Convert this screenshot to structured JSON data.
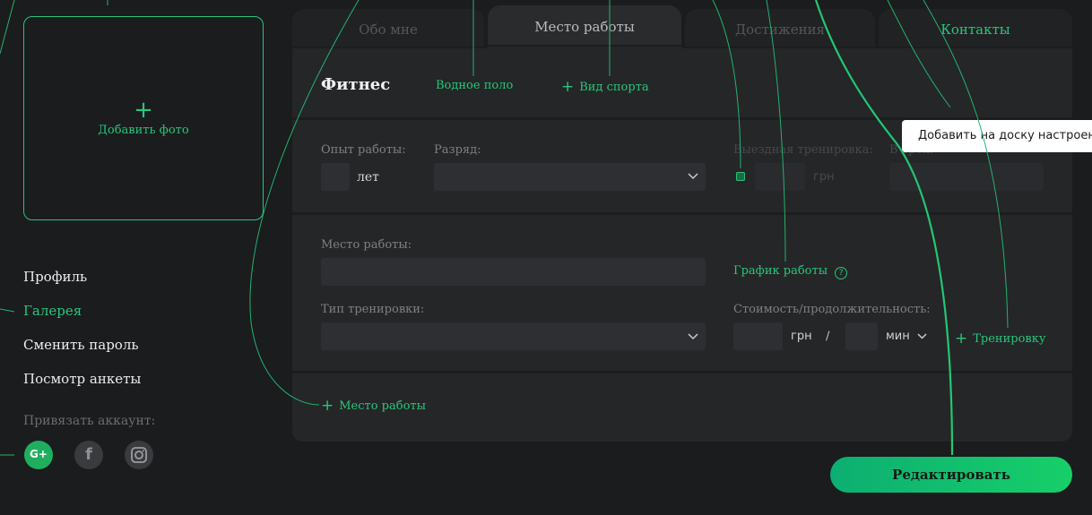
{
  "photo": {
    "plus": "+",
    "label": "Добавить фото"
  },
  "menu": {
    "items": [
      {
        "label": "Профиль",
        "active": false
      },
      {
        "label": "Галерея",
        "active": true
      },
      {
        "label": "Сменить пароль",
        "active": false
      },
      {
        "label": "Посмотр анкеты",
        "active": false
      }
    ],
    "bind_account_label": "Привязать аккаунт:"
  },
  "social": [
    {
      "icon": "google-plus-icon",
      "text": "G+",
      "color": "#1fae5e"
    },
    {
      "icon": "facebook-icon",
      "text": "f",
      "color": "#393b3e"
    },
    {
      "icon": "instagram-icon",
      "text": "",
      "color": "#393b3e"
    }
  ],
  "tabs": [
    {
      "label": "Обо мне",
      "active": false
    },
    {
      "label": "Место работы",
      "active": true
    },
    {
      "label": "Достижения",
      "active": false
    },
    {
      "label": "Контакты",
      "active": false
    }
  ],
  "sport": {
    "title": "Фитнес",
    "sub_sport": "Водное поло",
    "add_sport": "Вид спорта"
  },
  "row1": {
    "experience_label": "Опыт работы:",
    "experience_value": "",
    "experience_unit": "лет",
    "rank_label": "Разряд:",
    "rank_value": "",
    "outdoor_label": "Выездная тренировка:",
    "outdoor_unit": "грн",
    "in_time_label": "В срок:"
  },
  "row2": {
    "workplace_label": "Место работы:",
    "workplace_value": "",
    "schedule_link": "График работы",
    "schedule_help": "?",
    "training_type_label": "Тип тренировки:",
    "training_type_value": "",
    "cost_label": "Стоимость/продолжительность:",
    "cost_unit": "грн",
    "separator": "/",
    "duration_unit": "мин",
    "add_training": "Тренировку"
  },
  "add_workplace": "Место работы",
  "tooltip": "Добавить на доску настроения",
  "edit_button": "Редактировать",
  "colors": {
    "accent": "#27c77a",
    "background": "#1b1c1e",
    "card": "#252628"
  }
}
